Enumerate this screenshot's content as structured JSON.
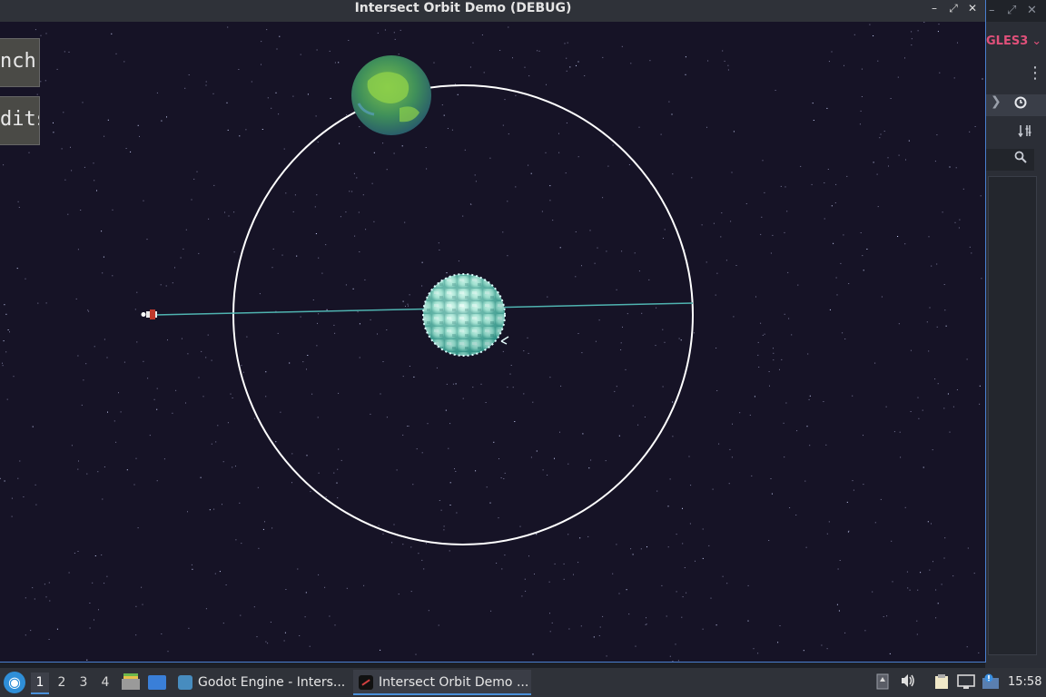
{
  "window": {
    "title": "Intersect Orbit Demo (DEBUG)",
    "controls": {
      "minimize": "–",
      "restore": "⤢",
      "close": "✕"
    }
  },
  "game": {
    "menu": [
      {
        "label": "nch!"
      },
      {
        "label": "dits"
      }
    ],
    "colors": {
      "background": "#161326",
      "orbit_ring": "#ffffff",
      "trajectory": "#4fb3b0",
      "sun": "#c8f0e6",
      "planet": "#3f8f5a"
    }
  },
  "editor": {
    "renderer": "GLES3",
    "chevron": "⌄",
    "kebab": "⋮",
    "back_arrow": "❯",
    "icons": [
      "history-icon",
      "filter-icon",
      "search-icon"
    ]
  },
  "taskbar": {
    "start_icon": "start-menu-icon",
    "desktops": [
      "1",
      "2",
      "3",
      "4"
    ],
    "tasks": [
      {
        "label": "Godot Engine - Inters..."
      },
      {
        "label": "Intersect Orbit Demo ..."
      }
    ],
    "clock": "15:58"
  }
}
